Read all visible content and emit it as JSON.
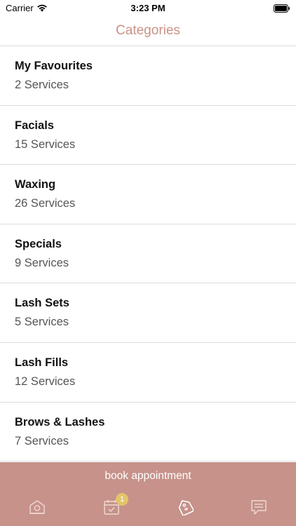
{
  "status_bar": {
    "carrier": "Carrier",
    "time": "3:23 PM"
  },
  "nav": {
    "title": "Categories"
  },
  "categories": [
    {
      "name": "My Favourites",
      "count": "2 Services"
    },
    {
      "name": "Facials",
      "count": "15 Services"
    },
    {
      "name": "Waxing",
      "count": "26 Services"
    },
    {
      "name": "Specials",
      "count": "9 Services"
    },
    {
      "name": "Lash Sets",
      "count": "5 Services"
    },
    {
      "name": "Lash Fills",
      "count": "12 Services"
    },
    {
      "name": "Brows & Lashes",
      "count": "7 Services"
    }
  ],
  "bottom": {
    "book_label": "book appointment",
    "appointments_badge": "1",
    "tabs": [
      "home-icon",
      "calendar-icon",
      "tag-icon",
      "message-icon"
    ]
  },
  "colors": {
    "accent": "#c6928a",
    "title": "#c99284",
    "badge": "#e3c46a"
  }
}
